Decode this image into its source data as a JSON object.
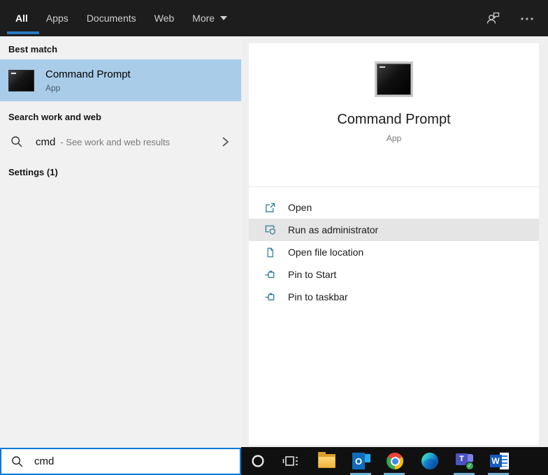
{
  "header": {
    "tabs": [
      {
        "label": "All",
        "active": true
      },
      {
        "label": "Apps",
        "active": false
      },
      {
        "label": "Documents",
        "active": false
      },
      {
        "label": "Web",
        "active": false
      },
      {
        "label": "More",
        "active": false,
        "has_dropdown": true
      }
    ],
    "right_icons": [
      {
        "icon": "feedback-icon"
      },
      {
        "icon": "ellipsis-icon"
      }
    ]
  },
  "left_panel": {
    "best_match": {
      "header": "Best match",
      "result_title": "Command Prompt",
      "result_subtitle": "App",
      "icon": "command-prompt-icon"
    },
    "search_web": {
      "header": "Search work and web",
      "query": "cmd",
      "hint": "- See work and web results",
      "icon": "search-icon",
      "chevron": "chevron-right-icon"
    },
    "settings_header": "Settings (1)"
  },
  "right_panel": {
    "app": {
      "title": "Command Prompt",
      "subtitle": "App",
      "icon": "command-prompt-icon"
    },
    "actions": [
      {
        "label": "Open",
        "icon": "open-icon",
        "highlighted": false
      },
      {
        "label": "Run as administrator",
        "icon": "run-as-admin-shield-icon",
        "highlighted": true
      },
      {
        "label": "Open file location",
        "icon": "file-location-icon",
        "highlighted": false
      },
      {
        "label": "Pin to Start",
        "icon": "pin-icon",
        "highlighted": false
      },
      {
        "label": "Pin to taskbar",
        "icon": "pin-icon",
        "highlighted": false
      }
    ]
  },
  "search_box": {
    "value": "cmd",
    "icon": "search-icon"
  },
  "taskbar": {
    "items": [
      {
        "name": "cortana",
        "icon": "cortana-icon",
        "running": false
      },
      {
        "name": "task-view",
        "icon": "task-view-icon",
        "running": false
      },
      {
        "name": "file-explorer",
        "icon": "file-explorer-icon",
        "running": false
      },
      {
        "name": "outlook",
        "icon": "outlook-icon",
        "glyph": "O",
        "running": true
      },
      {
        "name": "chrome",
        "icon": "chrome-icon",
        "running": true
      },
      {
        "name": "edge",
        "icon": "edge-icon",
        "running": false
      },
      {
        "name": "teams",
        "icon": "teams-icon",
        "glyph": "T",
        "badge_glyph": "✓",
        "running": true
      },
      {
        "name": "word",
        "icon": "word-icon",
        "glyph": "W",
        "running": true
      }
    ]
  },
  "colors": {
    "topbar_background": "#1d1d1d",
    "tab_underline": "#2b7ac0",
    "accent_blue": "#0078d7",
    "best_match_highlight": "#a9cce9",
    "action_hover_gray": "#e5e5e5",
    "action_icon_teal": "#2e7e96",
    "taskbar_background": "#101010",
    "taskbar_running_indicator": "#71aed6"
  }
}
